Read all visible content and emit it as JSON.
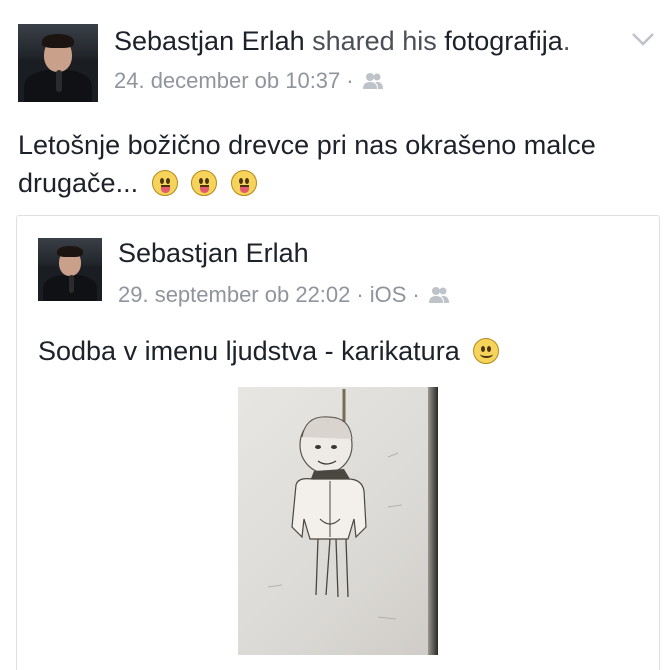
{
  "post": {
    "author": "Sebastjan Erlah",
    "verb": "shared his",
    "object": "fotografija",
    "period": ".",
    "timestamp": "24. december ob 10:37",
    "separator": "·",
    "privacy_icon": "friends-icon",
    "menu_icon": "chevron-down-icon",
    "text": "Letošnje božično drevce pri nas okrašeno malce drugače...",
    "emojis": [
      "tongue-out-emoji",
      "tongue-out-emoji",
      "tongue-out-emoji"
    ]
  },
  "shared": {
    "author": "Sebastjan Erlah",
    "timestamp": "29. september ob 22:02",
    "separator": "·",
    "source": "iOS",
    "privacy_icon": "friends-icon",
    "text": "Sodba v imenu ljudstva - karikatura",
    "emoji": "smile-emoji",
    "photo": "caricature-drawing-photo"
  },
  "colors": {
    "text": "#1d2129",
    "meta": "#90949c",
    "border": "#dddfe2",
    "emoji": "#f6d35b"
  }
}
